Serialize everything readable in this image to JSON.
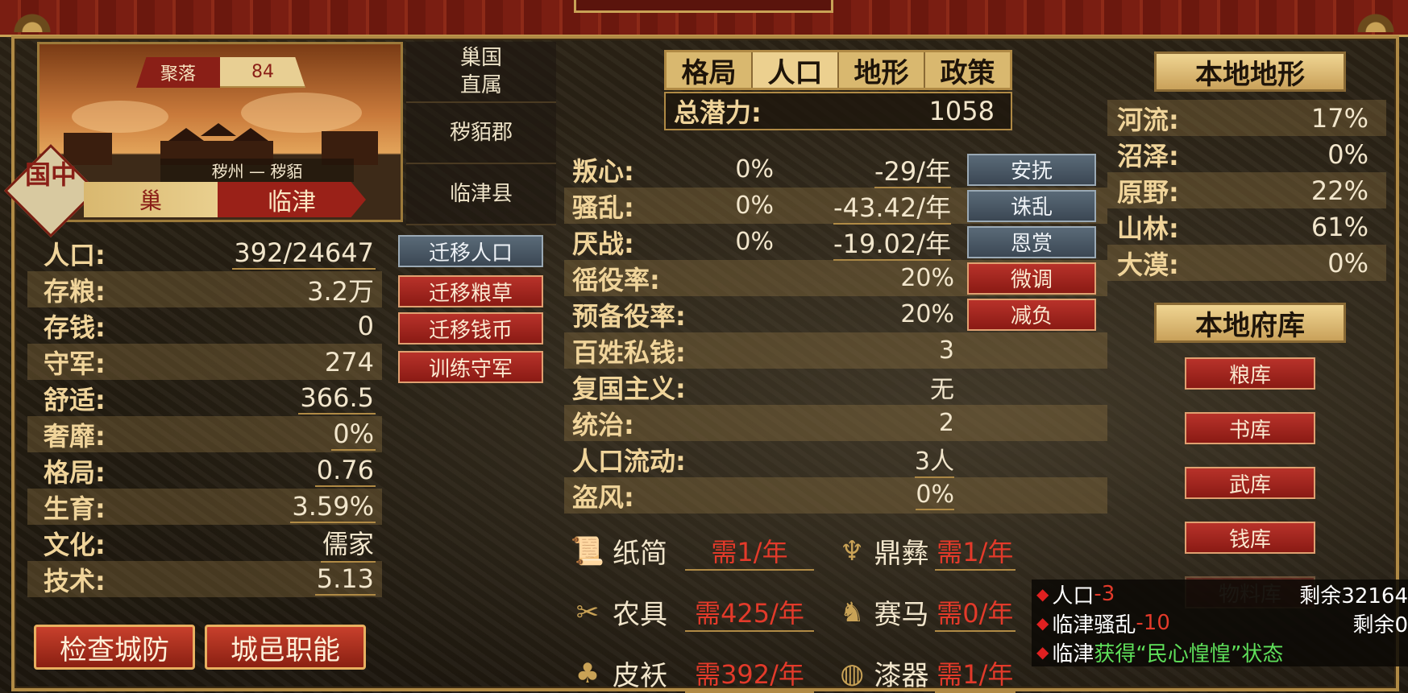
{
  "settlement": {
    "label": "聚落",
    "value": "84"
  },
  "region_line": "秽州 — 秽貊",
  "seal_text": "国中",
  "state_tabs": {
    "left": "巢",
    "right": "临津"
  },
  "hierarchy": [
    "巢国\n直属",
    "秽貊郡",
    "临津县"
  ],
  "left_stats": [
    {
      "label": "人口:",
      "value": "392/24647",
      "underline": true
    },
    {
      "label": "存粮:",
      "value": "3.2万",
      "underline": false
    },
    {
      "label": "存钱:",
      "value": "0",
      "underline": false
    },
    {
      "label": "守军:",
      "value": "274",
      "underline": false
    },
    {
      "label": "舒适:",
      "value": "366.5",
      "underline": true
    },
    {
      "label": "奢靡:",
      "value": "0%",
      "underline": true
    },
    {
      "label": "格局:",
      "value": "0.76",
      "underline": true
    },
    {
      "label": "生育:",
      "value": "3.59%",
      "underline": true
    },
    {
      "label": "文化:",
      "value": "儒家",
      "underline": true
    },
    {
      "label": "技术:",
      "value": "5.13",
      "underline": true
    }
  ],
  "left_actions": [
    "迁移人口",
    "迁移粮草",
    "迁移钱币",
    "训练守军"
  ],
  "bottom_buttons": [
    "检查城防",
    "城邑职能"
  ],
  "mid_tabs": [
    "格局",
    "人口",
    "地形",
    "政策"
  ],
  "potential": {
    "label": "总潜力:",
    "value": "1058"
  },
  "mid_stats": [
    {
      "label": "叛心:",
      "pct": "0%",
      "rate": "-29/年",
      "button": "安抚",
      "btn_style": "blue"
    },
    {
      "label": "骚乱:",
      "pct": "0%",
      "rate": "-43.42/年",
      "button": "诛乱",
      "btn_style": "blue"
    },
    {
      "label": "厌战:",
      "pct": "0%",
      "rate": "-19.02/年",
      "button": "恩赏",
      "btn_style": "blue"
    },
    {
      "label": "徭役率:",
      "right": "20%",
      "button": "微调",
      "btn_style": "red"
    },
    {
      "label": "预备役率:",
      "right": "20%",
      "button": "减负",
      "btn_style": "red"
    },
    {
      "label": "百姓私钱:",
      "right": "3"
    },
    {
      "label": "复国主义:",
      "right": "无"
    },
    {
      "label": "统治:",
      "right": "2"
    },
    {
      "label": "人口流动:",
      "right": "3人"
    },
    {
      "label": "盗风:",
      "right": "0%"
    }
  ],
  "supplies": [
    {
      "icon": "scroll-icon",
      "glyph": "📜",
      "name": "纸简",
      "need": "需1/年"
    },
    {
      "icon": "cauldron-icon",
      "glyph": "♆",
      "name": "鼎彝",
      "need": "需1/年"
    },
    {
      "icon": "tools-icon",
      "glyph": "✂",
      "name": "农具",
      "need": "需425/年"
    },
    {
      "icon": "horse-icon",
      "glyph": "♞",
      "name": "赛马",
      "need": "需0/年"
    },
    {
      "icon": "robe-icon",
      "glyph": "♣",
      "name": "皮袄",
      "need": "需392/年"
    },
    {
      "icon": "lacquer-icon",
      "glyph": "◍",
      "name": "漆器",
      "need": "需1/年"
    }
  ],
  "terrain_title": "本地地形",
  "terrain": [
    {
      "label": "河流:",
      "value": "17%"
    },
    {
      "label": "沼泽:",
      "value": "0%"
    },
    {
      "label": "原野:",
      "value": "22%"
    },
    {
      "label": "山林:",
      "value": "61%"
    },
    {
      "label": "大漠:",
      "value": "0%"
    }
  ],
  "treasury_title": "本地府库",
  "treasury": [
    "粮库",
    "书库",
    "武库",
    "钱库",
    "物料库"
  ],
  "log": [
    {
      "a": "人口",
      "b": "-3",
      "rem": "剩余32164"
    },
    {
      "a": "临津骚乱",
      "b": "-10",
      "rem": "剩余0"
    },
    {
      "a": "临津",
      "g": "获得“民心惶惶”状态"
    }
  ],
  "colors": {
    "accent_red": "#9a2118",
    "gold": "#c9a256",
    "need_red": "#e33a2a",
    "log_green": "#5fe05a"
  }
}
